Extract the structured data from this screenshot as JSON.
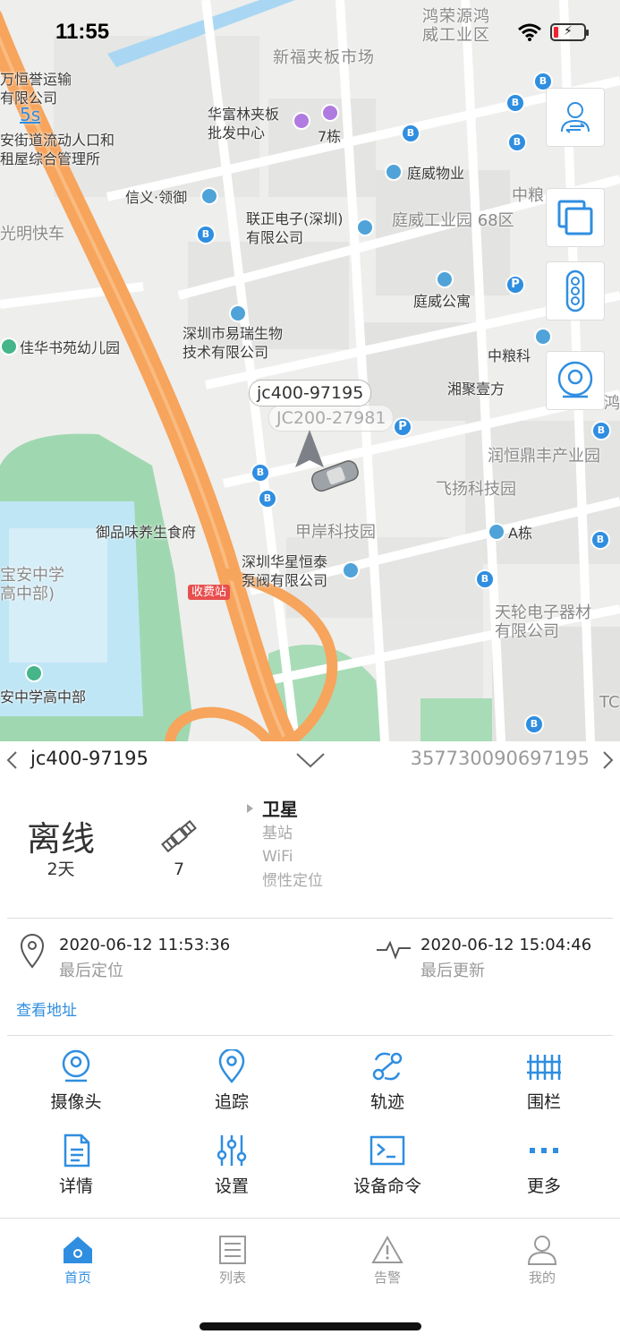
{
  "status_bar": {
    "time": "11:55"
  },
  "map": {
    "speed_label": "5s",
    "labels": {
      "hongrong": "鸿荣源鸿\n威工业区",
      "xinfu": "新福夹板市场",
      "hengyu": "万恒誉运输\n有限公司",
      "huafulin": "华富林夹板\n批发中心",
      "qidong": "7栋",
      "anjie": "安街道流动人口和\n租屋综合管理所",
      "tingwei_wuye": "庭威物业",
      "xinyi": "信义·领御",
      "zhongliang": "中粮",
      "lianzheng": "联正电子(深圳)\n有限公司",
      "tingwei_park": "庭威工业园 68区",
      "guangming": "光明快车",
      "tingwei_gy": "庭威公寓",
      "yirui": "深圳市易瑞生物\n技术有限公司",
      "jiahua": "佳华书苑幼儿园",
      "zhongliangke": "中粮科",
      "xiangjv": "湘聚壹方",
      "hong2": "鸿",
      "runheng": "润恒鼎丰产业园",
      "feiyang": "飞扬科技园",
      "yupin": "御品味养生食府",
      "jiaan": "甲岸科技园",
      "adong": "A栋",
      "baoan_zhong": "宝安中学\n高中部)",
      "huaxing": "深圳华星恒泰\n泵阀有限公司",
      "shoufei": "收费站",
      "tianlun": "天轮电子器材\n有限公司",
      "anzhong": "安中学高中部",
      "tc": "TC"
    },
    "device_tag": "jc400-97195",
    "ghost_tag": "JC200-27981"
  },
  "device": {
    "name": "jc400-97195",
    "imei": "357730090697195"
  },
  "status": {
    "state": "离线",
    "duration": "2天",
    "satellites": "7",
    "loc_modes": [
      "卫星",
      "基站",
      "WiFi",
      "惯性定位"
    ]
  },
  "times": {
    "last_location": "2020-06-12 11:53:36",
    "last_location_label": "最后定位",
    "last_update": "2020-06-12 15:04:46",
    "last_update_label": "最后更新",
    "view_address": "查看地址"
  },
  "actions": {
    "camera": "摄像头",
    "track": "追踪",
    "trajectory": "轨迹",
    "fence": "围栏",
    "details": "详情",
    "settings": "设置",
    "command": "设备命令",
    "more": "更多"
  },
  "tabs": {
    "home": "首页",
    "list": "列表",
    "alarm": "告警",
    "mine": "我的"
  },
  "colors": {
    "accent": "#2f8ee0",
    "road": "#f7a45c",
    "park": "#9fd8b0",
    "water": "#a9d7f3"
  }
}
